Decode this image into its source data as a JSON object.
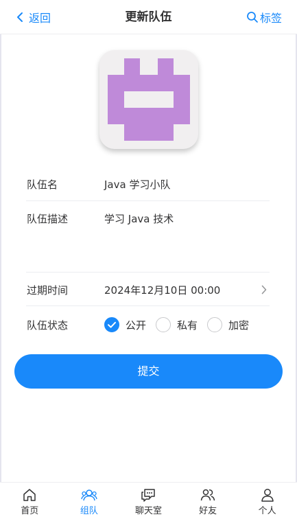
{
  "nav": {
    "back_label": "返回",
    "title": "更新队伍",
    "right_label": "标签"
  },
  "form": {
    "name_label": "队伍名",
    "name_value": "Java 学习小队",
    "desc_label": "队伍描述",
    "desc_value": "学习 Java 技术",
    "expire_label": "过期时间",
    "expire_value": "2024年12月10日 00:00",
    "status_label": "队伍状态",
    "status_options": [
      "公开",
      "私有",
      "加密"
    ],
    "status_selected": "公开"
  },
  "submit_label": "提交",
  "tabbar": {
    "items": [
      {
        "label": "首页",
        "icon": "home-icon"
      },
      {
        "label": "组队",
        "icon": "team-icon"
      },
      {
        "label": "聊天室",
        "icon": "chat-icon"
      },
      {
        "label": "好友",
        "icon": "friends-icon"
      },
      {
        "label": "个人",
        "icon": "user-icon"
      }
    ],
    "active": "组队"
  },
  "colors": {
    "accent": "#1989fa",
    "avatar_purple": "#bf8ad9",
    "avatar_bg": "#f1eff0"
  }
}
